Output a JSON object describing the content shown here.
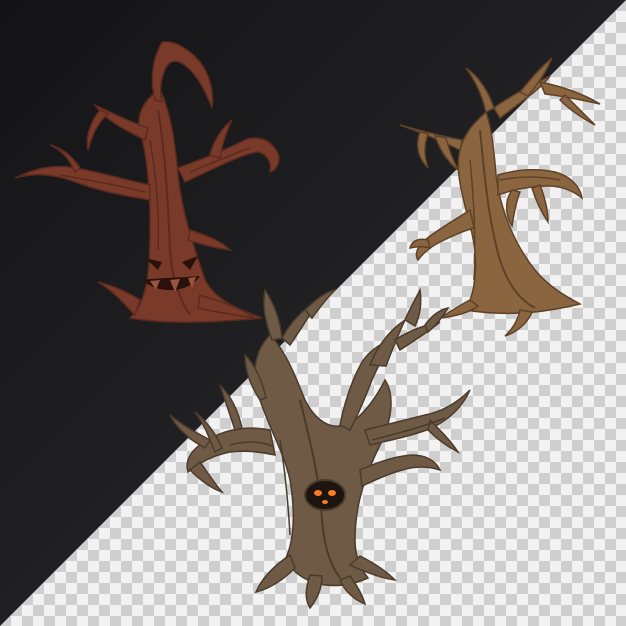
{
  "scene": {
    "background": {
      "dark_gradient": [
        "#141416",
        "#2c2c2f"
      ],
      "checker_light": "#f2f2f2",
      "checker_dark": "#cfcfcf"
    },
    "objects": [
      {
        "label": "red-face-tree",
        "trunk": "#7a3a2a",
        "shade": "#5c2a1f",
        "highlight": "#9a5340",
        "face": "#2a110b"
      },
      {
        "label": "brown-dead-tree",
        "trunk": "#8a6540",
        "shade": "#5e4228",
        "highlight": "#a8845a"
      },
      {
        "label": "hollow-eye-tree",
        "trunk": "#6e5a45",
        "shade": "#4a3b2c",
        "highlight": "#8c7660",
        "eyes": "#ff7a20"
      }
    ]
  }
}
